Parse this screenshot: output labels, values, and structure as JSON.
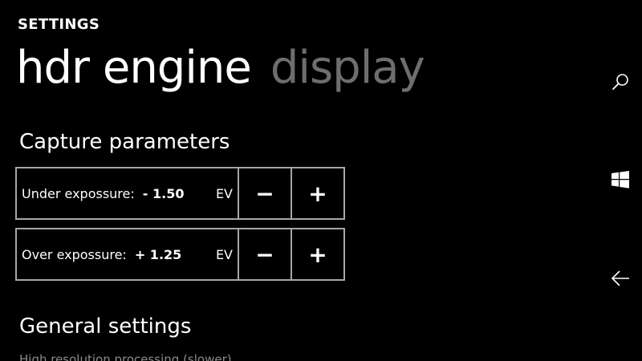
{
  "header": {
    "title": "SETTINGS"
  },
  "pivot": {
    "items": [
      {
        "label": "hdr engine",
        "active": true
      },
      {
        "label": "display",
        "active": false
      }
    ]
  },
  "capture": {
    "title": "Capture parameters",
    "rows": [
      {
        "label": "Under expossure:",
        "value": "- 1.50",
        "unit": "EV",
        "minus": "−",
        "plus": "+"
      },
      {
        "label": "Over expossure:",
        "value": "+ 1.25",
        "unit": "EV",
        "minus": "−",
        "plus": "+"
      }
    ]
  },
  "general": {
    "title": "General settings",
    "first_item": "High resolution processing (slower)"
  },
  "side_icons": [
    "search-icon",
    "windows-icon",
    "back-icon"
  ],
  "colors": {
    "background": "#000000",
    "foreground": "#ffffff",
    "inactive": "#6e6e6e",
    "border": "#a6a6a6"
  }
}
